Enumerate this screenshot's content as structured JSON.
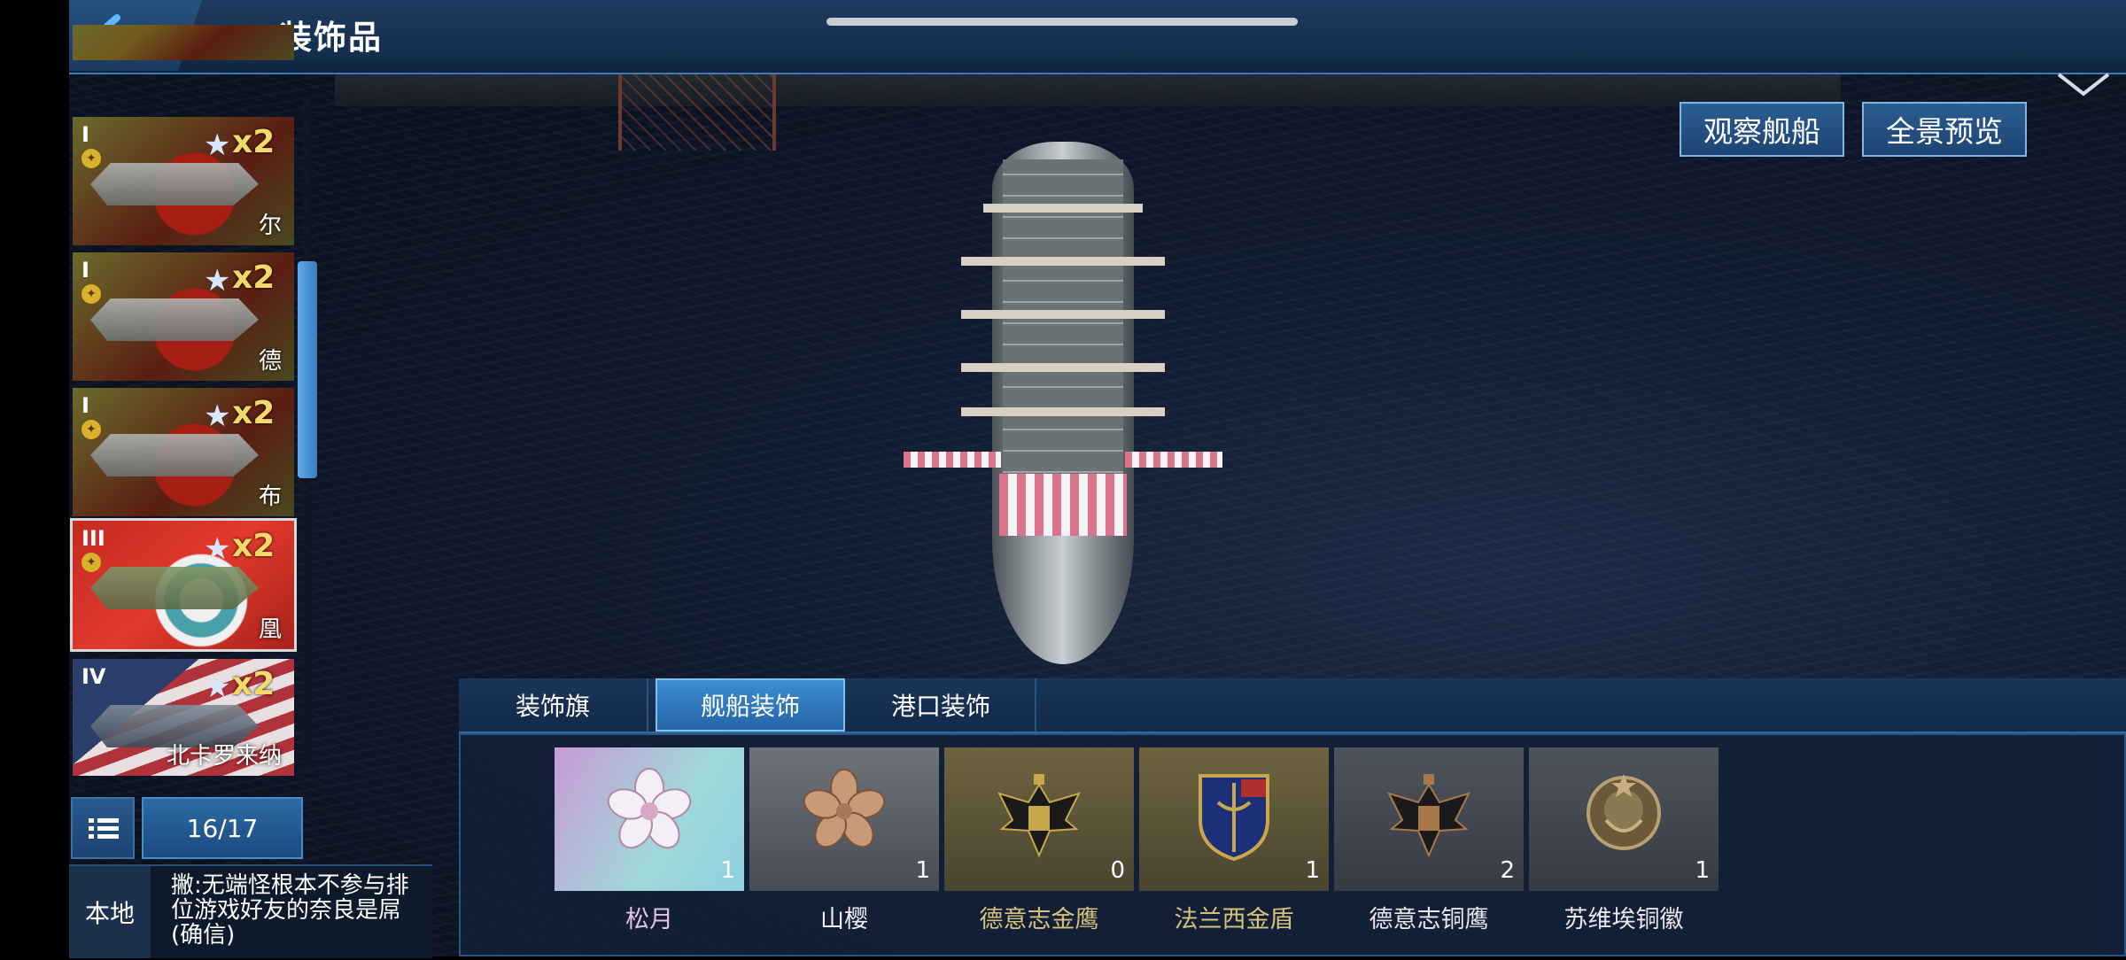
{
  "header": {
    "title": "装饰品"
  },
  "view_buttons": {
    "observe": "观察舰船",
    "panorama": "全景预览"
  },
  "ship_list": {
    "items": [
      {
        "tier": "I",
        "multiplier": "x2",
        "name": "尔"
      },
      {
        "tier": "I",
        "multiplier": "x2",
        "name": "德"
      },
      {
        "tier": "I",
        "multiplier": "x2",
        "name": "布"
      },
      {
        "tier": "III",
        "multiplier": "x2",
        "name": "凰",
        "selected": true
      },
      {
        "tier": "IV",
        "multiplier": "x2",
        "name": "北卡罗来纳"
      }
    ],
    "count": "16/17"
  },
  "chat": {
    "channel": "本地",
    "message": "撇:无端怪根本不参与排位游戏好友的奈良是屌(确信)"
  },
  "tabs": [
    {
      "label": "装饰旗",
      "active": false
    },
    {
      "label": "舰船装饰",
      "active": true
    },
    {
      "label": "港口装饰",
      "active": false
    }
  ],
  "decorations": [
    {
      "name": "松月",
      "qty": "1",
      "color": "#e6c0e8",
      "icon": "cherry-blossom-icon"
    },
    {
      "name": "山樱",
      "qty": "1",
      "color": "#f0f0f0",
      "icon": "cherry-blossom-bronze-icon"
    },
    {
      "name": "德意志金鹰",
      "qty": "0",
      "color": "#d6c27a",
      "icon": "german-eagle-icon"
    },
    {
      "name": "法兰西金盾",
      "qty": "1",
      "color": "#d6c27a",
      "icon": "french-shield-icon"
    },
    {
      "name": "德意志铜鹰",
      "qty": "2",
      "color": "#e8e8e8",
      "icon": "german-eagle-bronze-icon"
    },
    {
      "name": "苏维埃铜徽",
      "qty": "1",
      "color": "#e8e8e8",
      "icon": "soviet-emblem-icon"
    }
  ]
}
